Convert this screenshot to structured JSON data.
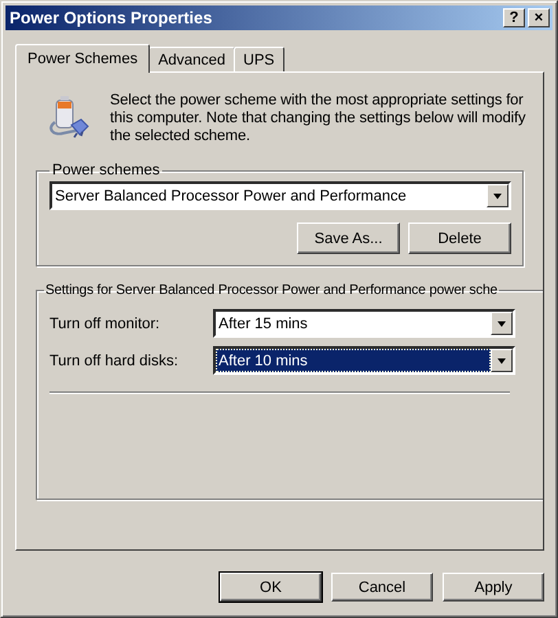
{
  "window": {
    "title": "Power Options Properties",
    "title_buttons": [
      "?",
      "×"
    ]
  },
  "tabs": [
    {
      "label": "Power Schemes",
      "selected": true
    },
    {
      "label": "Advanced",
      "selected": false
    },
    {
      "label": "UPS",
      "selected": false
    }
  ],
  "intro": "Select the power scheme with the most appropriate settings for this computer. Note that changing the settings below will modify the selected scheme.",
  "schemes_group": {
    "title": "Power schemes",
    "value": "Server Balanced Processor Power and Performance",
    "buttons": [
      "Save As...",
      "Delete"
    ]
  },
  "settings_group": {
    "title": "Settings for Server Balanced Processor Power and Performance power sche",
    "rows": [
      {
        "label": "Turn off monitor:",
        "value": "After 15 mins",
        "focused": false
      },
      {
        "label": "Turn off hard disks:",
        "value": "After 10 mins",
        "focused": true
      }
    ]
  },
  "buttons": [
    {
      "label": "OK",
      "default": true
    },
    {
      "label": "Cancel",
      "default": false
    },
    {
      "label": "Apply",
      "default": false
    }
  ]
}
